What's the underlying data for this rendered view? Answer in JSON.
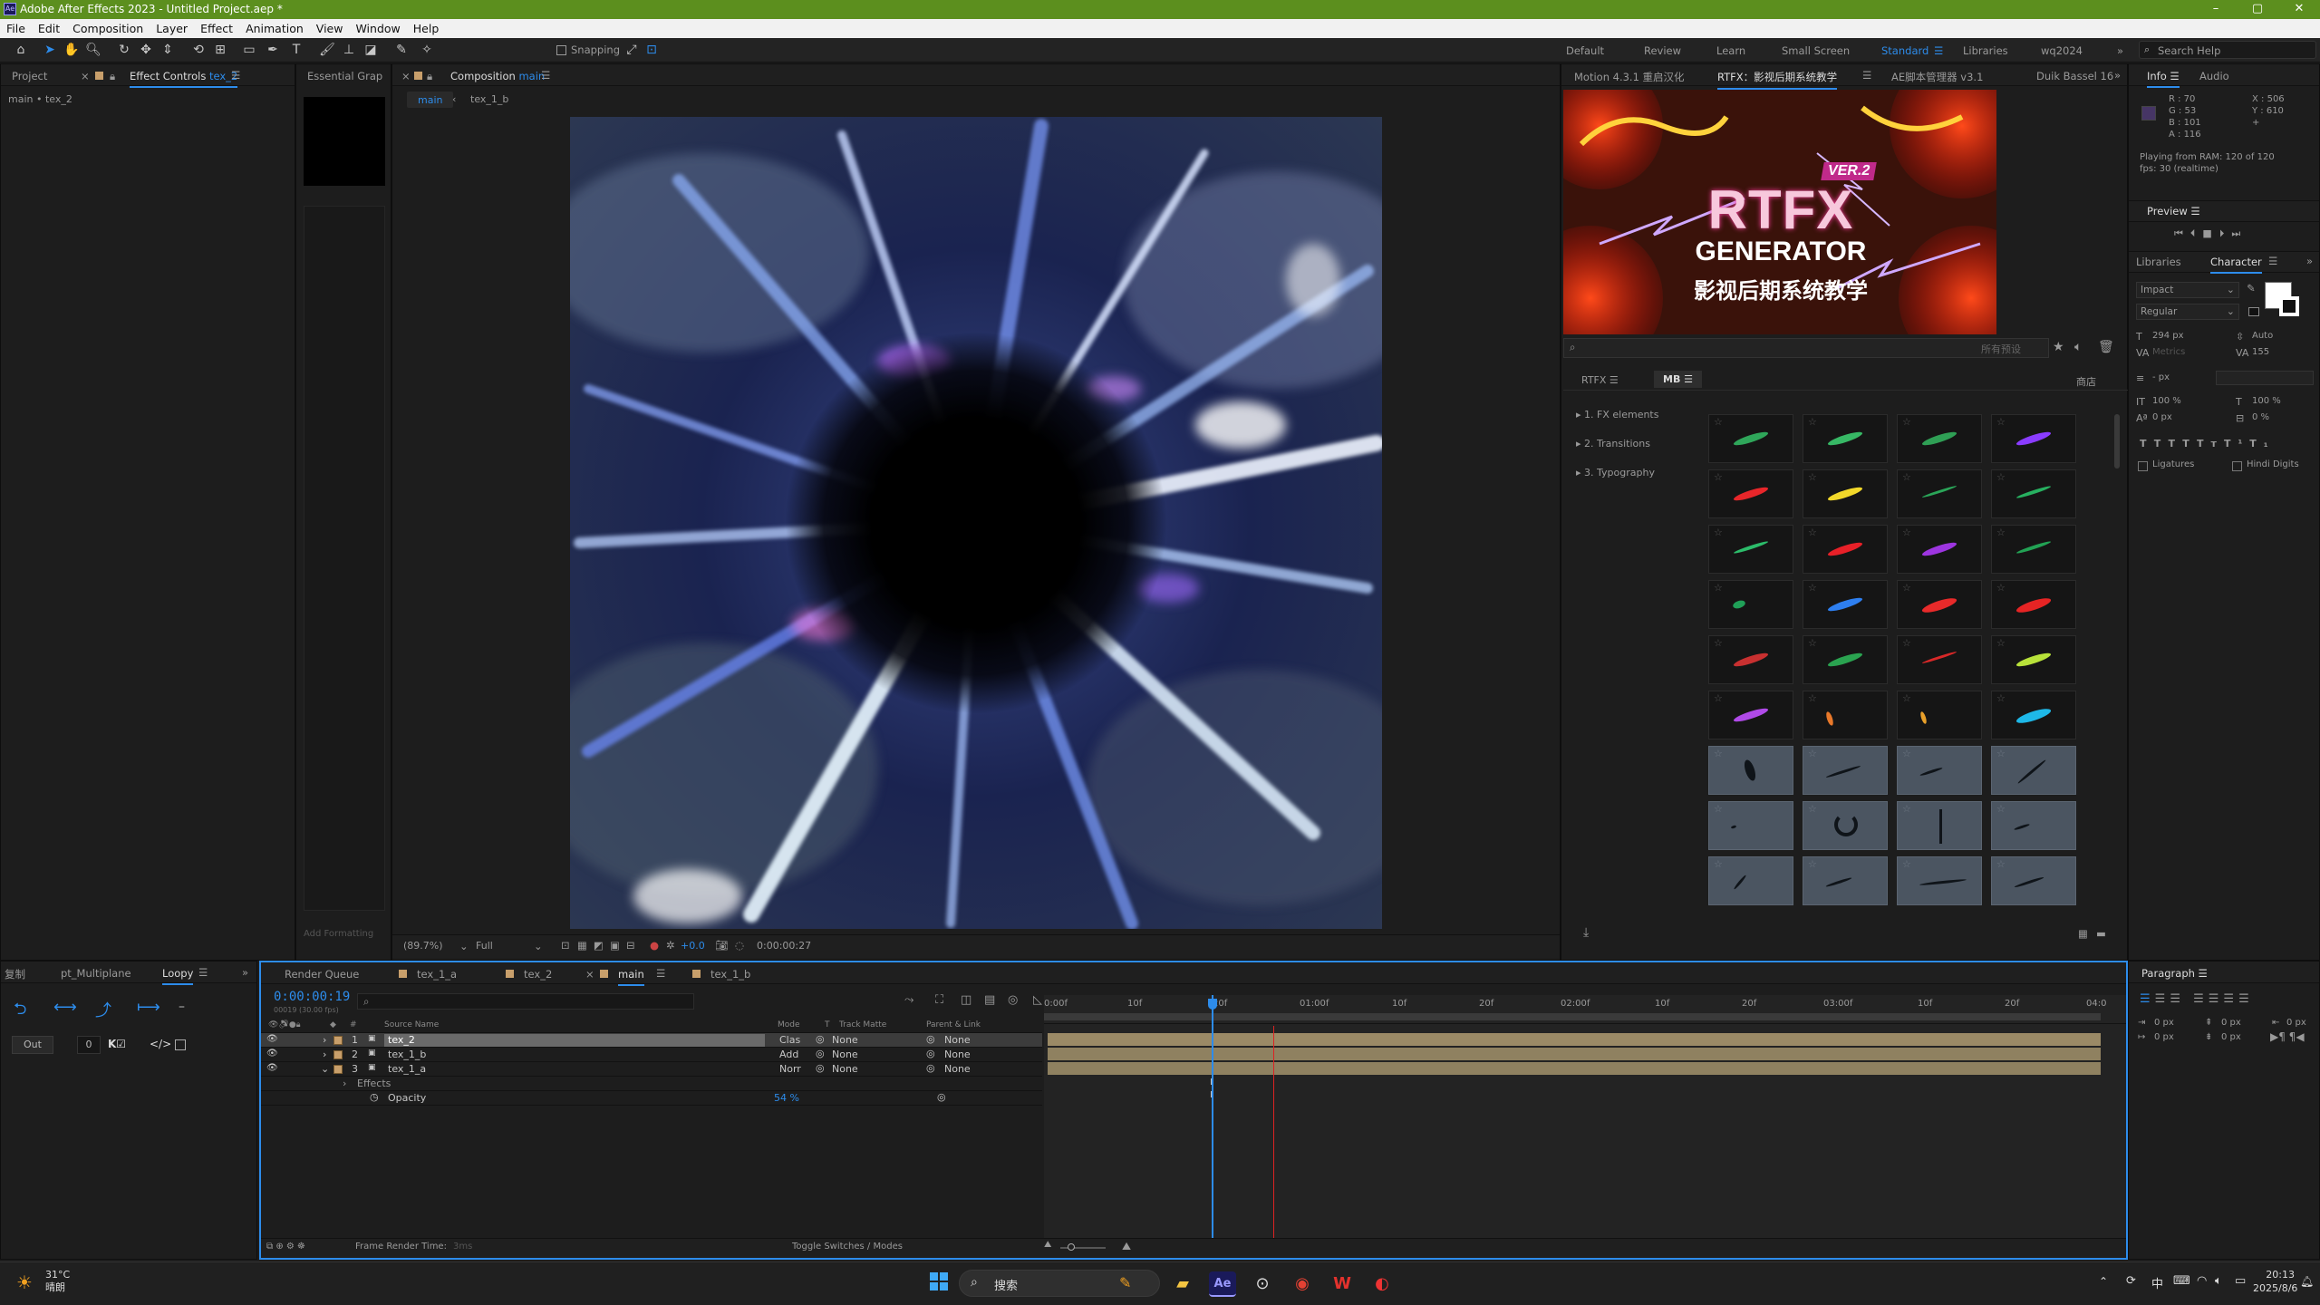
{
  "title_bar": {
    "title": "Adobe After Effects 2023 - Untitled Project.aep *",
    "app_icon": "ae-icon",
    "controls": [
      "minimize-icon",
      "maximize-icon",
      "close-icon"
    ]
  },
  "menu": [
    "File",
    "Edit",
    "Composition",
    "Layer",
    "Effect",
    "Animation",
    "View",
    "Window",
    "Help"
  ],
  "toolbar": {
    "snapping": "Snapping"
  },
  "workspaces": [
    "Default",
    "Review",
    "Learn",
    "Small Screen",
    "Standard",
    "Libraries",
    "wq2024"
  ],
  "search_help": "Search Help",
  "project_panel": {
    "tab_project": "Project",
    "tab_effect_controls": "Effect Controls",
    "effect_layer": "tex_2",
    "breadcrumb": "main • tex_2"
  },
  "essential_graphics": {
    "tab": "Essential Grap",
    "add_formatting": "Add Formatting"
  },
  "composition": {
    "tab_label": "Composition",
    "comp_name": "main",
    "crumb_main": "main",
    "crumb_sub": "tex_1_b",
    "zoom": "(89.7%)",
    "resolution": "Full",
    "exposure": "+0.0",
    "timecode": "0:00:00:27"
  },
  "extension_tabs": [
    "Motion 4.3.1 重启汉化",
    "RTFX：影视后期系统教学",
    "AE脚本管理器 v3.1",
    "Duik Bassel 16"
  ],
  "rtfx": {
    "banner_ver": "VER.2",
    "banner_title": "RTFX",
    "banner_sub": "GENERATOR",
    "banner_cn": "影视后期系统教学",
    "search_placeholder": "所有预设",
    "tab_rtfx": "RTFX",
    "tab_mb": "MB",
    "store": "商店",
    "tree": [
      "1. FX elements",
      "2. Transitions",
      "3. Typography"
    ]
  },
  "info": {
    "tab_info": "Info",
    "tab_audio": "Audio",
    "r": "R : 70",
    "g": "G : 53",
    "b": "B : 101",
    "a": "A : 116",
    "x": "X : 506",
    "y": "Y : 610",
    "playing": "Playing from RAM: 120 of 120",
    "fps": "fps: 30 (realtime)",
    "swatch_color": "#463565"
  },
  "preview": {
    "title": "Preview"
  },
  "character": {
    "tab_libraries": "Libraries",
    "tab_character": "Character",
    "font": "Impact",
    "style": "Regular",
    "size": "294 px",
    "leading": "Auto",
    "kerning": "Metrics",
    "tracking": "155",
    "stroke": "- px",
    "vscale": "100 %",
    "hscale": "100 %",
    "baseline": "0 px",
    "tsume": "0 %",
    "ligatures": "Ligatures",
    "hindi": "Hindi Digits"
  },
  "paragraph": {
    "title": "Paragraph",
    "indent_a": "0 px",
    "indent_b": "0 px",
    "indent_c": "0 px",
    "space_a": "0 px",
    "space_b": "0 px"
  },
  "left_bottom": {
    "tab_a": "复制",
    "tab_b": "pt_Multiplane",
    "tab_c": "Loopy",
    "out_label": "Out",
    "count": "0"
  },
  "timeline": {
    "tabs": [
      "Render Queue",
      "tex_1_a",
      "tex_2",
      "main",
      "tex_1_b"
    ],
    "current_time": "0:00:00:19",
    "frame_info": "00019 (30.00 fps)",
    "col_source": "Source Name",
    "col_mode": "Mode",
    "col_t": "T",
    "col_matte": "Track Matte",
    "col_parent": "Parent & Link",
    "layers": [
      {
        "num": "1",
        "name": "tex_2",
        "mode": "Clas",
        "matte": "None",
        "parent": "None"
      },
      {
        "num": "2",
        "name": "tex_1_b",
        "mode": "Add",
        "matte": "None",
        "parent": "None"
      },
      {
        "num": "3",
        "name": "tex_1_a",
        "mode": "Norr",
        "matte": "None",
        "parent": "None"
      }
    ],
    "effects_label": "Effects",
    "opacity_label": "Opacity",
    "opacity_value": "54 %",
    "ruler": [
      "0:00f",
      "10f",
      "20f",
      "01:00f",
      "10f",
      "20f",
      "02:00f",
      "10f",
      "20f",
      "03:00f",
      "10f",
      "20f",
      "04:0"
    ],
    "render_time_label": "Frame Render Time:",
    "render_time": "3ms",
    "toggle": "Toggle Switches / Modes",
    "playhead_frame": 19,
    "red_marker_frame": 26,
    "total_frames": 120
  },
  "taskbar": {
    "temp": "31°C",
    "weather": "晴朗",
    "search": "搜索",
    "time": "20:13",
    "date": "2025/8/6",
    "ime": "中"
  }
}
